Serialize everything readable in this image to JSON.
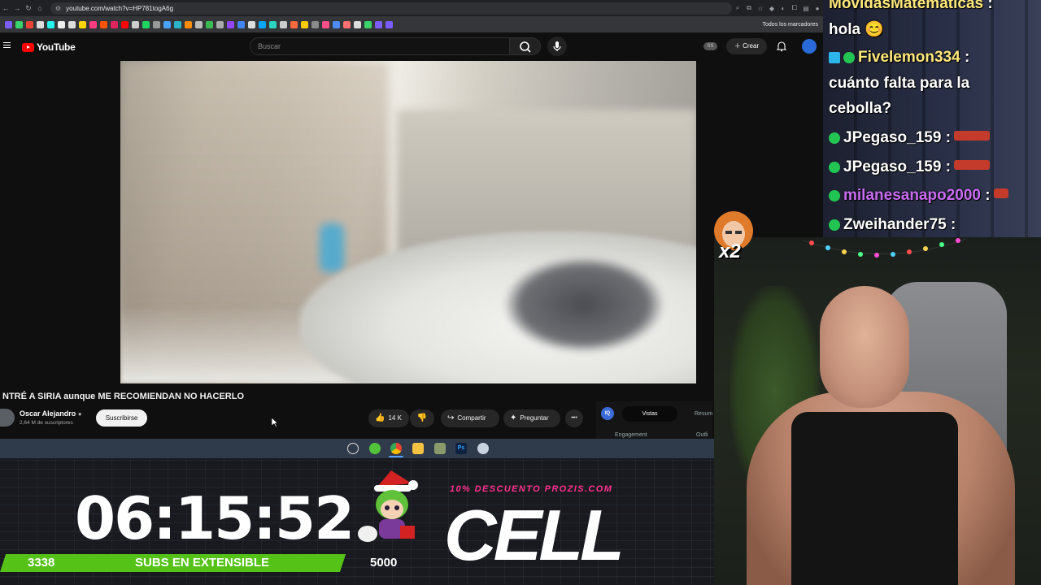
{
  "browser": {
    "url": "youtube.com/watch?v=HP781togA6g",
    "bookmarks_all": "Todos los marcadores"
  },
  "youtube": {
    "logo_text": "YouTube",
    "search_placeholder": "Buscar",
    "ss_badge": "SS",
    "create_label": "Crear",
    "video_title": "NTRÉ A SIRIA aunque ME RECOMIENDAN NO HACERLO",
    "channel_name": "Oscar Alejandro",
    "channel_subs": "2,64 M de suscriptores",
    "subscribe_label": "Suscribirse",
    "likes": "14 K",
    "share_label": "Compartir",
    "ask_label": "Preguntar",
    "more_label": "•••",
    "iq_label": "IQ",
    "tab_views": "Vistas",
    "tab_summary": "Resum",
    "label_engagement": "Engagement",
    "label_outline": "Outli"
  },
  "overlay": {
    "timer": "06:15:52",
    "subs_count": "3338",
    "subs_text": "SUBS EN EXTENSIBLE",
    "goal": "5000",
    "promo": "10% DESCUENTO PROZIS.COM",
    "sponsor": "CELL",
    "reaction_multiplier": "x2"
  },
  "chat": {
    "messages": [
      {
        "user": "MovidasMatematicas",
        "sep": " :",
        "color": "#ffe97a"
      },
      {
        "text": "hola 😊"
      },
      {
        "user": "Fivelemon334",
        "sep": " :",
        "color": "#ffe97a"
      },
      {
        "text": "cuánto falta para la"
      },
      {
        "text": "cebolla?"
      },
      {
        "user": "JPegaso_159",
        "sep": " :",
        "color": "#ffffff"
      },
      {
        "user": "JPegaso_159",
        "sep": " :",
        "color": "#ffffff"
      },
      {
        "user": "milanesanapo2000",
        "sep": " :",
        "color": "#c86cf0"
      },
      {
        "user": "Zweihander75",
        "sep": " :",
        "color": "#ffffff"
      }
    ]
  }
}
